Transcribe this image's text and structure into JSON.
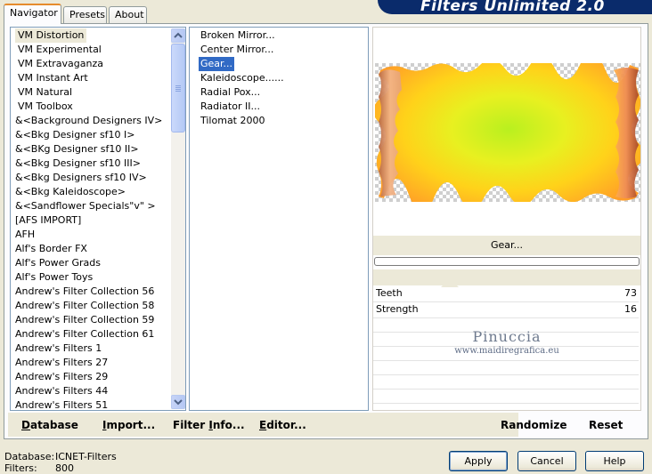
{
  "tabs": [
    {
      "label": "Navigator",
      "active": true
    },
    {
      "label": "Presets",
      "active": false
    },
    {
      "label": "About",
      "active": false
    }
  ],
  "banner": {
    "title": "Filters Unlimited 2.0"
  },
  "categories": {
    "items": [
      "VM Distortion",
      "VM Experimental",
      "VM Extravaganza",
      "VM Instant Art",
      "VM Natural",
      "VM Toolbox",
      "&<Background Designers IV>",
      "&<Bkg Designer sf10 I>",
      "&<BKg Designer sf10 II>",
      "&<Bkg Designer sf10 III>",
      "&<Bkg Designers sf10 IV>",
      "&<Bkg Kaleidoscope>",
      "&<Sandflower Specials\"v\" >",
      "[AFS IMPORT]",
      "AFH",
      "Alf's Border FX",
      "Alf's Power Grads",
      "Alf's Power Toys",
      "Andrew's Filter Collection 56",
      "Andrew's Filter Collection 58",
      "Andrew's Filter Collection 59",
      "Andrew's Filter Collection 61",
      "Andrew's Filters 1",
      "Andrew's Filters 27",
      "Andrew's Filters 29",
      "Andrew's Filters 44",
      "Andrew's Filters 51"
    ],
    "selected_index": 0
  },
  "filters": {
    "items": [
      "Broken Mirror...",
      "Center Mirror...",
      "Gear...",
      "Kaleidoscope......",
      "Radial Pox...",
      "Radiator II...",
      "Tilomat 2000"
    ],
    "selected_index": 2
  },
  "preview": {
    "filter_name": "Gear...",
    "watermark_line1": "Pinuccia",
    "watermark_line2": "www.maidiregrafica.eu"
  },
  "parameters": [
    {
      "name": "Teeth",
      "value": "73"
    },
    {
      "name": "Strength",
      "value": "16"
    }
  ],
  "toolbar": {
    "database": {
      "ul": "D",
      "rest": "atabase"
    },
    "import": {
      "ul": "I",
      "rest": "mport..."
    },
    "filter_info": {
      "pre": "Filter ",
      "ul": "I",
      "rest": "nfo..."
    },
    "editor": {
      "ul": "E",
      "rest": "ditor..."
    },
    "randomize": "Randomize",
    "reset": "Reset"
  },
  "status": {
    "database_label": "Database:",
    "database_value": "ICNET-Filters",
    "filters_label": "Filters:",
    "filters_value": "800"
  },
  "dialog_buttons": {
    "apply": "Apply",
    "cancel": "Cancel",
    "help": "Help"
  },
  "colors": {
    "selection": "#316ac5",
    "border": "#7f9db9",
    "banner": "#0a2b6b"
  }
}
